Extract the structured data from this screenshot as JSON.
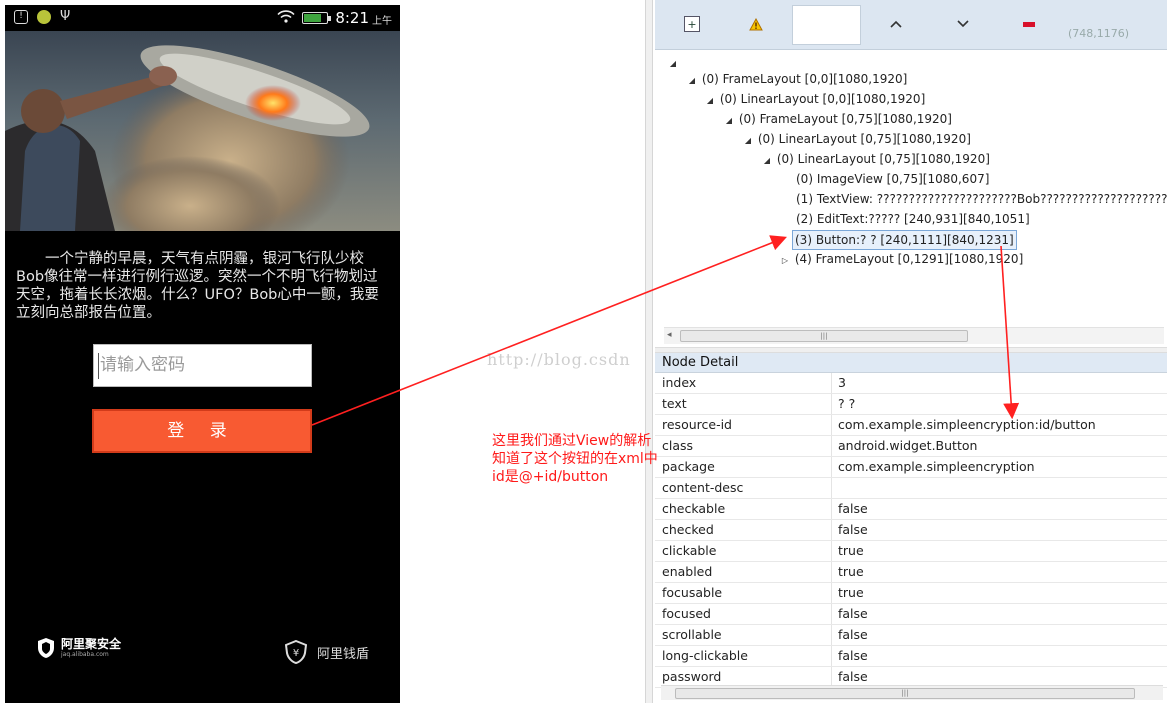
{
  "phone": {
    "status_time": "8:21",
    "status_ampm": "上午",
    "story_text": "一个宁静的早晨，天气有点阴霾，银河飞行队少校Bob像往常一样进行例行巡逻。突然一个不明飞行物划过天空，拖着长长浓烟。什么？UFO？Bob心中一颤，我要立刻向总部报告位置。",
    "password_placeholder": "请输入密码",
    "login_label": "登 录",
    "brand_left_name": "阿里聚安全",
    "brand_left_url": "jaq.alibaba.com",
    "brand_right_name": "阿里钱盾"
  },
  "toolbar": {
    "coords": "(748,1176)",
    "expand_glyph": "+",
    "up_glyph": "^",
    "down_glyph": "v"
  },
  "tree": {
    "root_glyph": "◢",
    "rows": [
      "(0) FrameLayout [0,0][1080,1920]",
      "(0) LinearLayout [0,0][1080,1920]",
      "(0) FrameLayout [0,75][1080,1920]",
      "(0) LinearLayout [0,75][1080,1920]",
      "(0) LinearLayout [0,75][1080,1920]",
      "(0) ImageView [0,75][1080,607]",
      "(1) TextView:    ??????????????????????Bob?????????????????????",
      "(2) EditText:????? [240,931][840,1051]",
      "(3) Button:?    ? [240,1111][840,1231]",
      "(4) FrameLayout [0,1291][1080,1920]"
    ],
    "scroll_grip": "|||"
  },
  "node_detail": {
    "title": "Node Detail",
    "rows": [
      {
        "key": "index",
        "value": "3"
      },
      {
        "key": "text",
        "value": "?   ?"
      },
      {
        "key": "resource-id",
        "value": "com.example.simpleencryption:id/button"
      },
      {
        "key": "class",
        "value": "android.widget.Button"
      },
      {
        "key": "package",
        "value": "com.example.simpleencryption"
      },
      {
        "key": "content-desc",
        "value": ""
      },
      {
        "key": "checkable",
        "value": "false"
      },
      {
        "key": "checked",
        "value": "false"
      },
      {
        "key": "clickable",
        "value": "true"
      },
      {
        "key": "enabled",
        "value": "true"
      },
      {
        "key": "focusable",
        "value": "true"
      },
      {
        "key": "focused",
        "value": "false"
      },
      {
        "key": "scrollable",
        "value": "false"
      },
      {
        "key": "long-clickable",
        "value": "false"
      },
      {
        "key": "password",
        "value": "false"
      }
    ],
    "scroll_grip": "|||"
  },
  "annotation": {
    "note_line1": "这里我们通过View的解析",
    "note_line2": "知道了这个按钮的在xml中",
    "note_line3": "id是@+id/button",
    "watermark": "http://blog.csdn",
    "color": "#ff2020"
  }
}
